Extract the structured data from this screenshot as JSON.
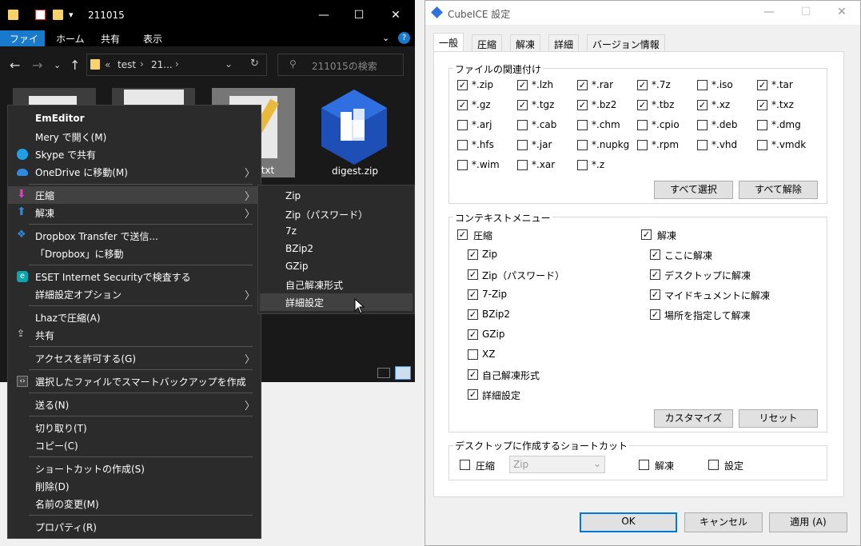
{
  "explorer": {
    "title": "211015",
    "ribbon": {
      "file": "ファイル",
      "home": "ホーム",
      "share": "共有",
      "view": "表示"
    },
    "address": {
      "root": "«",
      "part1": "test",
      "part2": "21..."
    },
    "search_placeholder": "211015の検索",
    "files": [
      {
        "name": ""
      },
      {
        "name": ""
      },
      {
        "name": "txt"
      },
      {
        "name": "digest.zip"
      }
    ]
  },
  "context_menu": {
    "items": [
      {
        "label": "EmEditor",
        "bold": true
      },
      {
        "label": "Mery で開く(M)"
      },
      {
        "label": "Skype で共有"
      },
      {
        "label": "OneDrive に移動(M)"
      },
      {
        "label": "圧縮"
      },
      {
        "label": "解凍"
      },
      {
        "label": "Dropbox Transfer で送信..."
      },
      {
        "label": "「Dropbox」に移動"
      },
      {
        "label": "ESET Internet Securityで検査する"
      },
      {
        "label": "詳細設定オプション"
      },
      {
        "label": "Lhazで圧縮(A)"
      },
      {
        "label": "共有"
      },
      {
        "label": "アクセスを許可する(G)"
      },
      {
        "label": "選択したファイルでスマートバックアップを作成"
      },
      {
        "label": "送る(N)"
      },
      {
        "label": "切り取り(T)"
      },
      {
        "label": "コピー(C)"
      },
      {
        "label": "ショートカットの作成(S)"
      },
      {
        "label": "削除(D)"
      },
      {
        "label": "名前の変更(M)"
      },
      {
        "label": "プロパティ(R)"
      }
    ],
    "submenu": [
      "Zip",
      "Zip（パスワード）",
      "7z",
      "BZip2",
      "GZip",
      "自己解凍形式",
      "詳細設定"
    ]
  },
  "cubeice": {
    "title": "CubeICE 設定",
    "tabs": [
      "一般",
      "圧縮",
      "解凍",
      "詳細",
      "バージョン情報"
    ],
    "assoc": {
      "label": "ファイルの関連付け",
      "items": [
        {
          "name": "*.zip",
          "checked": true
        },
        {
          "name": "*.lzh",
          "checked": true
        },
        {
          "name": "*.rar",
          "checked": true
        },
        {
          "name": "*.7z",
          "checked": true
        },
        {
          "name": "*.iso",
          "checked": false
        },
        {
          "name": "*.tar",
          "checked": true
        },
        {
          "name": "*.gz",
          "checked": true
        },
        {
          "name": "*.tgz",
          "checked": true
        },
        {
          "name": "*.bz2",
          "checked": true
        },
        {
          "name": "*.tbz",
          "checked": true
        },
        {
          "name": "*.xz",
          "checked": true
        },
        {
          "name": "*.txz",
          "checked": true
        },
        {
          "name": "*.arj",
          "checked": false
        },
        {
          "name": "*.cab",
          "checked": false
        },
        {
          "name": "*.chm",
          "checked": false
        },
        {
          "name": "*.cpio",
          "checked": false
        },
        {
          "name": "*.deb",
          "checked": false
        },
        {
          "name": "*.dmg",
          "checked": false
        },
        {
          "name": "*.hfs",
          "checked": false
        },
        {
          "name": "*.jar",
          "checked": false
        },
        {
          "name": "*.nupkg",
          "checked": false
        },
        {
          "name": "*.rpm",
          "checked": false
        },
        {
          "name": "*.vhd",
          "checked": false
        },
        {
          "name": "*.vmdk",
          "checked": false
        },
        {
          "name": "*.wim",
          "checked": false
        },
        {
          "name": "*.xar",
          "checked": false
        },
        {
          "name": "*.z",
          "checked": false
        }
      ],
      "select_all": "すべて選択",
      "deselect_all": "すべて解除"
    },
    "context": {
      "label": "コンテキストメニュー",
      "compress": {
        "label": "圧縮",
        "checked": true,
        "items": [
          {
            "name": "Zip",
            "checked": true
          },
          {
            "name": "Zip（パスワード）",
            "checked": true
          },
          {
            "name": "7-Zip",
            "checked": true
          },
          {
            "name": "BZip2",
            "checked": true
          },
          {
            "name": "GZip",
            "checked": true
          },
          {
            "name": "XZ",
            "checked": false
          },
          {
            "name": "自己解凍形式",
            "checked": true
          },
          {
            "name": "詳細設定",
            "checked": true
          }
        ]
      },
      "extract": {
        "label": "解凍",
        "checked": true,
        "items": [
          {
            "name": "ここに解凍",
            "checked": true
          },
          {
            "name": "デスクトップに解凍",
            "checked": true
          },
          {
            "name": "マイドキュメントに解凍",
            "checked": true
          },
          {
            "name": "場所を指定して解凍",
            "checked": true
          }
        ]
      },
      "customize": "カスタマイズ",
      "reset": "リセット"
    },
    "shortcut": {
      "label": "デスクトップに作成するショートカット",
      "compress": "圧縮",
      "compress_checked": false,
      "compress_type": "Zip",
      "extract": "解凍",
      "extract_checked": false,
      "settings": "設定",
      "settings_checked": false
    },
    "buttons": {
      "ok": "OK",
      "cancel": "キャンセル",
      "apply": "適用 (A)"
    }
  }
}
